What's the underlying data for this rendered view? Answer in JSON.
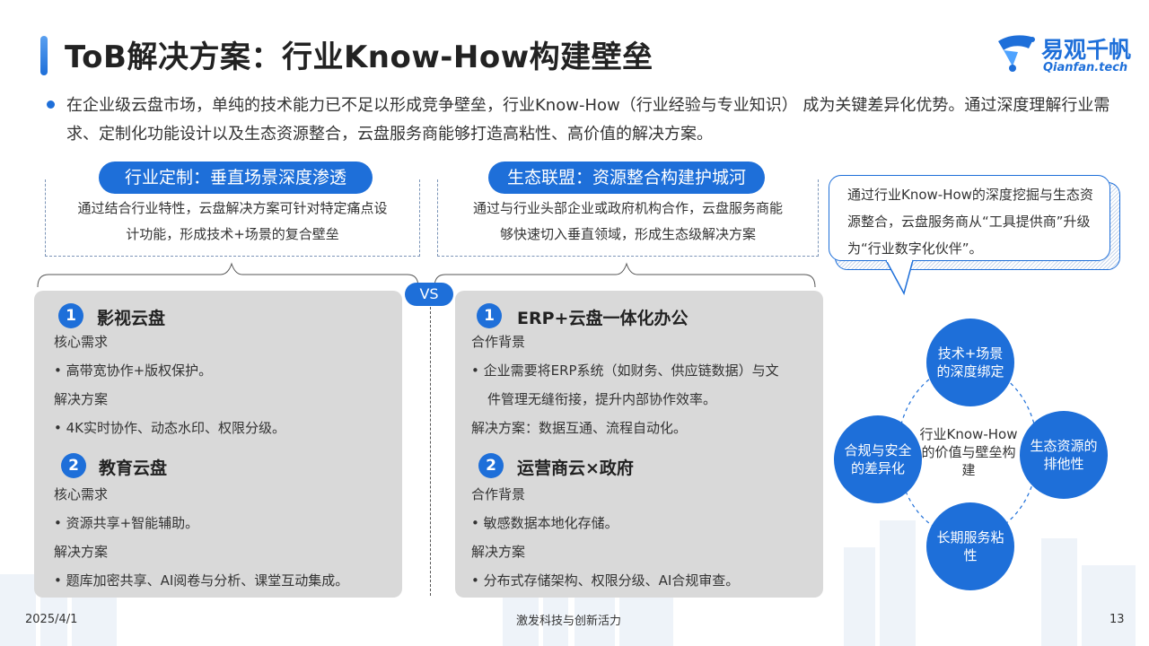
{
  "header": {
    "title": "ToB解决方案：行业Know-How构建壁垒",
    "logo_text": "易观千帆",
    "logo_sub": "Qianfan.tech"
  },
  "intro": "在企业级云盘市场，单纯的技术能力已不足以形成竞争壁垒，行业Know-How（行业经验与专业知识） 成为关键差异化优势。通过深度理解行业需求、定制化功能设计以及生态资源整合，云盘服务商能够打造高粘性、高价值的解决方案。",
  "left_pill": {
    "label": "行业定制：垂直场景深度渗透",
    "desc_line1": "通过结合行业特性，云盘解决方案可针对特定痛点设",
    "desc_line2": "计功能，形成技术+场景的复合壁垒"
  },
  "right_pill": {
    "label": "生态联盟：资源整合构建护城河",
    "desc_line1": "通过与行业头部企业或政府机构合作，云盘服务商能",
    "desc_line2": "够快速切入垂直领域，形成生态级解决方案"
  },
  "vs_label": "VS",
  "left_card": {
    "item1": {
      "num": "1",
      "title": "影视云盘",
      "need_label": "核心需求",
      "need": "• 高带宽协作+版权保护。",
      "sol_label": "解决方案",
      "sol": "• 4K实时协作、动态水印、权限分级。"
    },
    "item2": {
      "num": "2",
      "title": "教育云盘",
      "need_label": "核心需求",
      "need": "• 资源共享+智能辅助。",
      "sol_label": "解决方案",
      "sol": "• 题库加密共享、AI阅卷与分析、课堂互动集成。"
    }
  },
  "right_card": {
    "item1": {
      "num": "1",
      "title": "ERP+云盘一体化办公",
      "bg_label": "合作背景",
      "bg_line1": "• 企业需要将ERP系统（如财务、供应链数据）与文",
      "bg_line2": "件管理无缝衔接，提升内部协作效率。",
      "sol": "解决方案：数据互通、流程自动化。"
    },
    "item2": {
      "num": "2",
      "title": "运营商云×政府",
      "bg_label": "合作背景",
      "bg": "• 敏感数据本地化存储。",
      "sol_label": "解决方案",
      "sol": "• 分布式存储架构、权限分级、AI合规审查。"
    }
  },
  "callout": "通过行业Know-How的深度挖掘与生态资源整合，云盘服务商从“工具提供商”升级为“行业数字化伙伴”。",
  "cycle": {
    "center": "行业Know-How的价值与壁垒构建",
    "top": "技术+场景的深度绑定",
    "right": "生态资源的排他性",
    "bottom": "长期服务粘性",
    "left": "合规与安全的差异化"
  },
  "footer": {
    "date": "2025/4/1",
    "slogan": "激发科技与创新活力",
    "page": "13"
  },
  "colors": {
    "accent": "#1e6fd9",
    "card_bg": "#d9d9d9"
  }
}
